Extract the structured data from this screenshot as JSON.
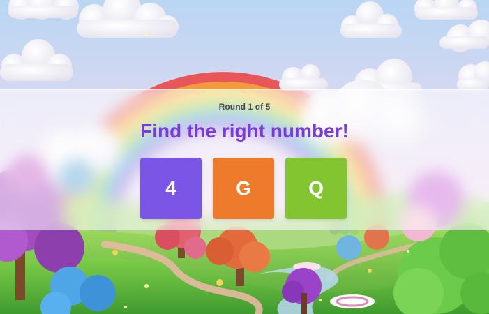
{
  "game": {
    "round_label": "Round 1 of 5",
    "prompt": "Find the right number!",
    "choices": [
      {
        "label": "4",
        "color": "#7a55e6"
      },
      {
        "label": "G",
        "color": "#ee7a2c"
      },
      {
        "label": "Q",
        "color": "#82c530"
      }
    ]
  },
  "theme": {
    "title_color": "#7b3ad9",
    "rainbow": [
      "#e8565a",
      "#f39a3d",
      "#f6d54a",
      "#7fcf5a",
      "#4fa8e8",
      "#8a63d8"
    ]
  }
}
